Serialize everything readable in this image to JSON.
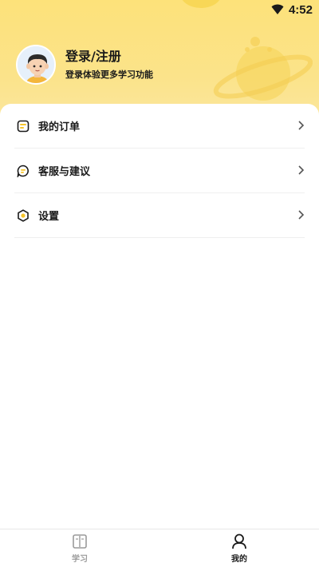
{
  "status_bar": {
    "time": "4:52",
    "wifi_icon": "wifi-icon"
  },
  "profile": {
    "title": "登录/注册",
    "subtitle": "登录体验更多学习功能",
    "avatar_icon": "avatar-boy"
  },
  "menu": {
    "items": [
      {
        "label": "我的订单",
        "icon": "order-icon"
      },
      {
        "label": "客服与建议",
        "icon": "chat-icon"
      },
      {
        "label": "设置",
        "icon": "settings-icon"
      }
    ]
  },
  "tabs": {
    "items": [
      {
        "label": "学习",
        "icon": "book-icon",
        "active": false
      },
      {
        "label": "我的",
        "icon": "user-icon",
        "active": true
      }
    ]
  },
  "colors": {
    "header_yellow": "#fde27a",
    "accent_yellow": "#f7c52b",
    "text_dark": "#1a1a1a",
    "text_gray": "#9a9a9a"
  }
}
